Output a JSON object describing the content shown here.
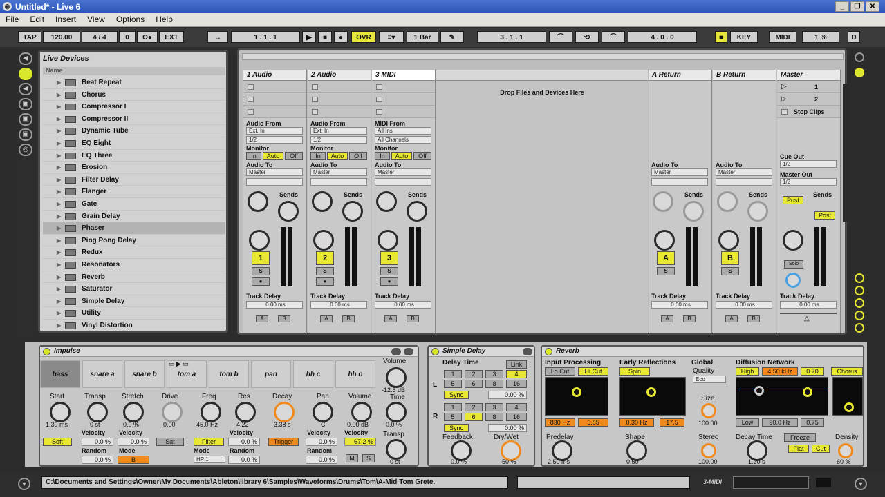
{
  "window": {
    "title": "Untitled* - Live 6",
    "buttons": [
      "_",
      "❐",
      "✕"
    ]
  },
  "menu": [
    "File",
    "Edit",
    "Insert",
    "View",
    "Options",
    "Help"
  ],
  "transport": {
    "tap": "TAP",
    "tempo": "120.00",
    "signature": "4 / 4",
    "groove": "0",
    "metronome": "O●",
    "ext": "EXT",
    "arrow": "→",
    "position": "1 . 1 . 1",
    "play": "▶",
    "stop": "■",
    "record": "●",
    "ovr": "OVR",
    "quant": "1 Bar",
    "loop_start": "3 . 1 . 1",
    "loop_len": "4 . 0 . 0",
    "key": "KEY",
    "midi": "MIDI",
    "cpu": "1 %",
    "d": "D"
  },
  "browser": {
    "title": "Live Devices",
    "column": "Name",
    "items": [
      "Beat Repeat",
      "Chorus",
      "Compressor I",
      "Compressor II",
      "Dynamic Tube",
      "EQ Eight",
      "EQ Three",
      "Erosion",
      "Filter Delay",
      "Flanger",
      "Gate",
      "Grain Delay",
      "Phaser",
      "Ping Pong Delay",
      "Redux",
      "Resonators",
      "Reverb",
      "Saturator",
      "Simple Delay",
      "Utility",
      "Vinyl Distortion"
    ],
    "selected": "Phaser"
  },
  "session": {
    "drop_text": "Drop Files and Devices Here",
    "tracks": [
      {
        "name": "1 Audio",
        "from_label": "Audio From",
        "from": "Ext. In",
        "chan": "1/2",
        "num": "1",
        "type": "audio"
      },
      {
        "name": "2 Audio",
        "from_label": "Audio From",
        "from": "Ext. In",
        "chan": "1/2",
        "num": "2",
        "type": "audio"
      },
      {
        "name": "3 MIDI",
        "from_label": "MIDI From",
        "from": "All Ins",
        "chan": "All Channels",
        "num": "3",
        "type": "midi"
      }
    ],
    "returns": [
      {
        "name": "A Return",
        "num": "A"
      },
      {
        "name": "B Return",
        "num": "B"
      }
    ],
    "master": {
      "name": "Master",
      "scenes": [
        "1",
        "2"
      ],
      "stop_clips": "Stop Clips",
      "cue_out": "Cue Out",
      "cue_val": "1/2",
      "master_out": "Master Out",
      "master_val": "1/2",
      "post": "Post",
      "solo": "Solo"
    },
    "labels": {
      "monitor": "Monitor",
      "in": "In",
      "auto": "Auto",
      "off": "Off",
      "audio_to": "Audio To",
      "master": "Master",
      "sends": "Sends",
      "track_delay": "Track Delay",
      "delay_val": "0.00 ms",
      "s": "S",
      "a": "A",
      "b": "B"
    }
  },
  "impulse": {
    "title": "Impulse",
    "pads": [
      "bass",
      "snare a",
      "snare b",
      "tom a",
      "tom b",
      "pan",
      "hh c",
      "hh o"
    ],
    "volume_label": "Volume",
    "volume_val": "-12.6 dB",
    "params": [
      {
        "label": "Start",
        "value": "1.30 ms"
      },
      {
        "label": "Transp",
        "value": "0 st"
      },
      {
        "label": "Stretch",
        "value": "0.0 %"
      },
      {
        "label": "Drive",
        "value": "0.00"
      },
      {
        "label": "Freq",
        "value": "45.0 Hz"
      },
      {
        "label": "Res",
        "value": "4.22"
      },
      {
        "label": "Decay",
        "value": "3.38 s"
      },
      {
        "label": "Pan",
        "value": "C"
      },
      {
        "label": "Volume",
        "value": "0.00 dB"
      }
    ],
    "soft": "Soft",
    "sat": "Sat",
    "filter": "Filter",
    "trigger": "Trigger",
    "mode_label": "Mode",
    "mode_val": "B",
    "filter_mode": "HP 1",
    "velocity": "Velocity",
    "random": "Random",
    "zero_pct": "0.0 %",
    "vel_val": "67.2 %",
    "time_label": "Time",
    "time_val": "0.0 %",
    "transp2": "Transp",
    "transp2_val": "0 st",
    "m": "M",
    "s": "S"
  },
  "simple_delay": {
    "title": "Simple Delay",
    "delay_time": "Delay Time",
    "link": "Link",
    "l": "L",
    "r": "R",
    "sync": "Sync",
    "grid_top": [
      "1",
      "2",
      "3",
      "4",
      "5",
      "6",
      "8",
      "16"
    ],
    "active_l": "4",
    "active_r": "6",
    "val_l": "0.00 %",
    "val_r": "0.00 %",
    "feedback": "Feedback",
    "feedback_val": "0.0 %",
    "drywet": "Dry/Wet",
    "drywet_val": "50 %"
  },
  "reverb": {
    "title": "Reverb",
    "input": "Input Processing",
    "lo_cut": "Lo Cut",
    "hi_cut": "Hi Cut",
    "early": "Early Reflections",
    "spin": "Spin",
    "global": "Global",
    "quality": "Quality",
    "quality_val": "Eco",
    "diffusion": "Diffusion Network",
    "high": "High",
    "high_val": "4.50 kHz",
    "high_q": "0.70",
    "chorus": "Chorus",
    "low": "Low",
    "low_val": "90.0 Hz",
    "low_q": "0.75",
    "in_vals": [
      "830 Hz",
      "5.85"
    ],
    "er_vals": [
      "0.30 Hz",
      "17.5"
    ],
    "size": "Size",
    "size_val": "100.00",
    "predelay": "Predelay",
    "predelay_val": "2.50 ms",
    "shape": "Shape",
    "shape_val": "0.50",
    "stereo": "Stereo",
    "stereo_val": "100.00",
    "decay": "Decay Time",
    "decay_val": "1.20 s",
    "freeze": "Freeze",
    "flat": "Flat",
    "cut": "Cut",
    "density": "Density",
    "density_val": "60 %"
  },
  "status": {
    "path": "C:\\Documents and Settings\\Owner\\My Documents\\Ableton\\library 6\\Samples\\Waveforms\\Drums\\Tom\\A-Mid Tom Grete.",
    "track": "3-MIDI"
  },
  "colors": {
    "accent_yellow": "#e8e832",
    "accent_orange": "#f08a1c",
    "panel": "#c9c9c9",
    "dark": "#2c2c2c"
  }
}
